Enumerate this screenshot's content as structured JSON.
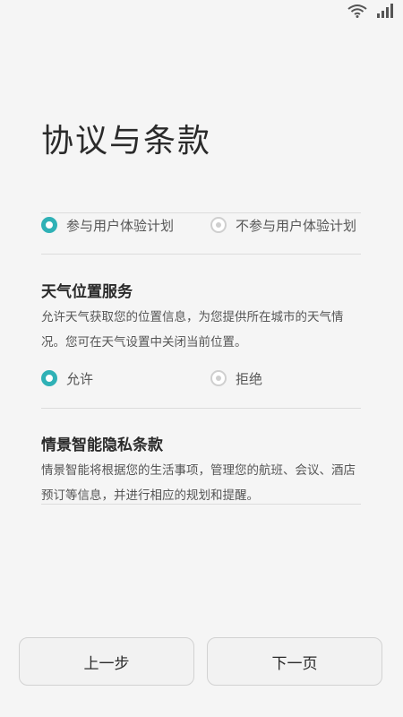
{
  "page": {
    "title": "协议与条款"
  },
  "experience_plan": {
    "options": [
      {
        "label": "参与用户体验计划",
        "selected": true
      },
      {
        "label": "不参与用户体验计划",
        "selected": false
      }
    ]
  },
  "weather_location": {
    "title": "天气位置服务",
    "description": "允许天气获取您的位置信息，为您提供所在城市的天气情况。您可在天气设置中关闭当前位置。",
    "options": [
      {
        "label": "允许",
        "selected": true
      },
      {
        "label": "拒绝",
        "selected": false
      }
    ]
  },
  "smart_context_privacy": {
    "title": "情景智能隐私条款",
    "description": "情景智能将根据您的生活事项，管理您的航班、会议、酒店预订等信息，并进行相应的规划和提醒。"
  },
  "navigation": {
    "prev_label": "上一步",
    "next_label": "下一页"
  },
  "status_bar": {
    "icons": [
      "wifi-icon",
      "signal-icon"
    ]
  },
  "colors": {
    "accent": "#2fb1b6",
    "background": "#f5f5f5",
    "text_primary": "#2a2a2a",
    "text_secondary": "#555555"
  }
}
